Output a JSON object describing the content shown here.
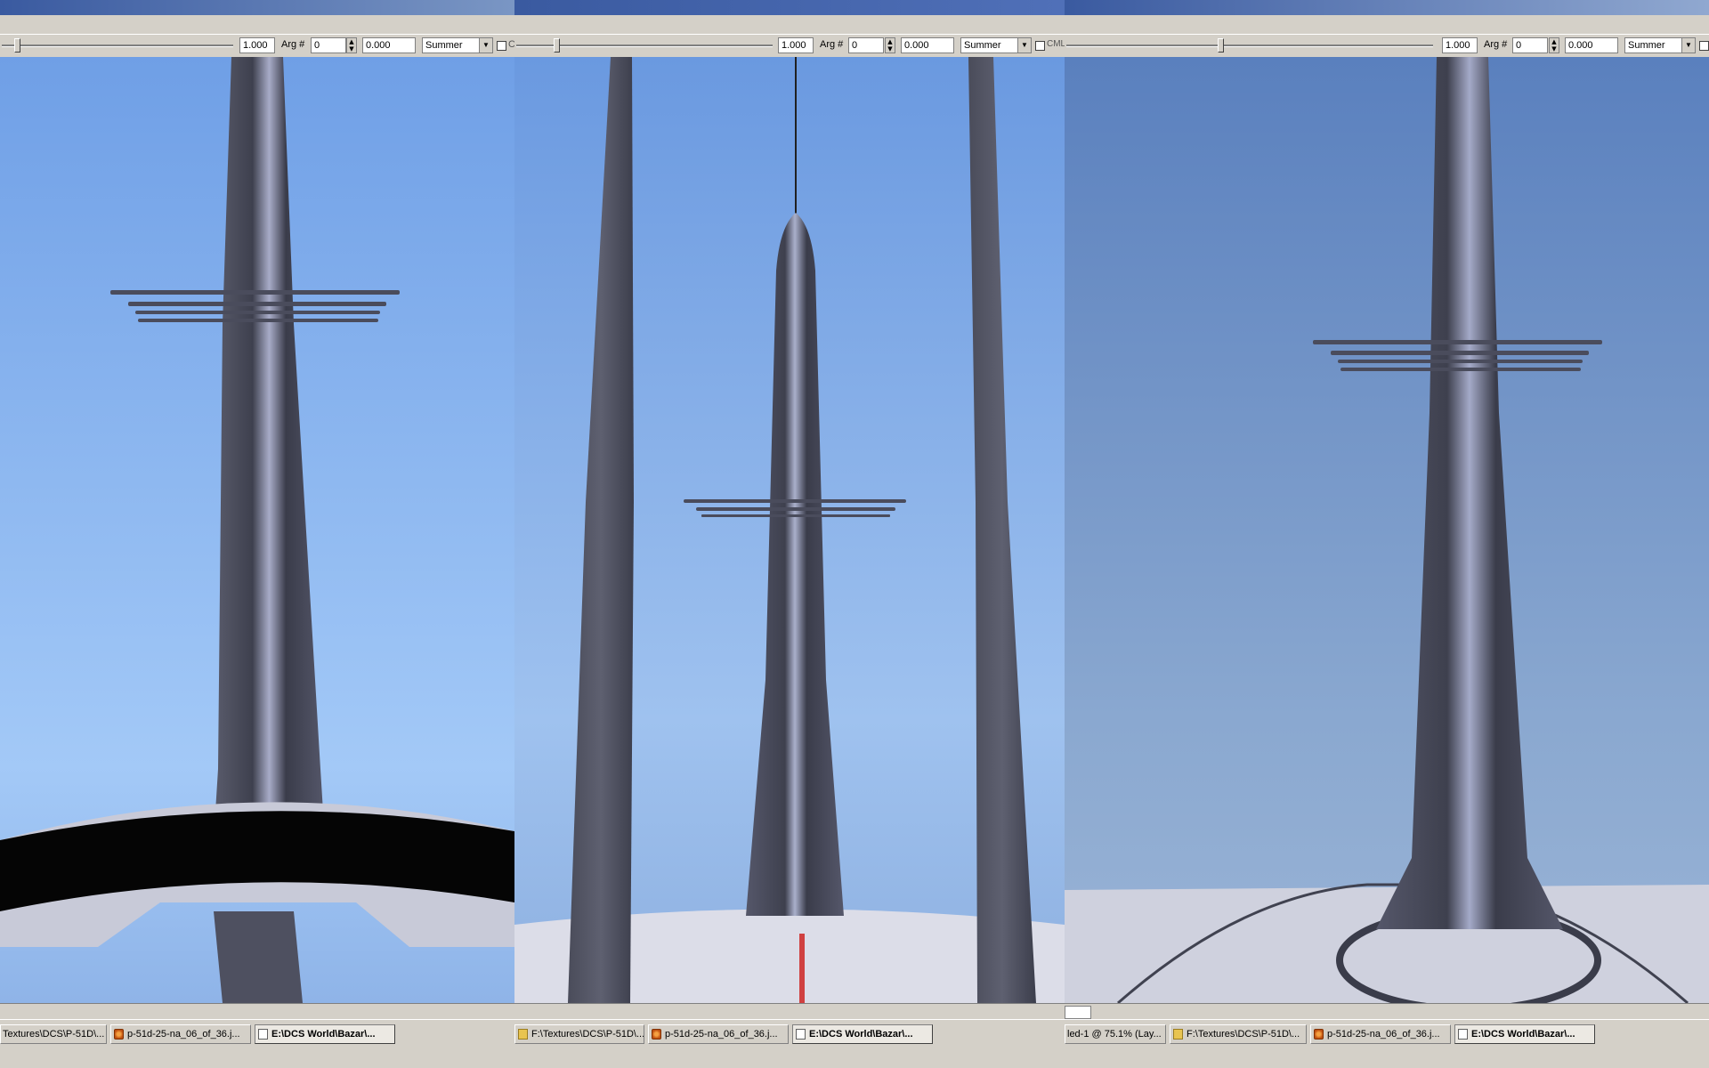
{
  "panes": [
    {
      "toolbar": {
        "scale_value": "1.000",
        "arg_label": "Arg #",
        "arg_value": "0",
        "arg_float": "0.000",
        "season": "Summer",
        "checkbox_label": "C"
      },
      "taskbar": [
        {
          "label": "Textures\\DCS\\P-51D\\...",
          "icon": "folder-icon",
          "active": false
        },
        {
          "label": "p-51d-25-na_06_of_36.j...",
          "icon": "image-icon",
          "active": false
        },
        {
          "label": "E:\\DCS World\\Bazar\\...",
          "icon": "document-icon",
          "active": true
        }
      ]
    },
    {
      "toolbar": {
        "scale_value": "1.000",
        "arg_label": "Arg #",
        "arg_value": "0",
        "arg_float": "0.000",
        "season": "Summer",
        "checkbox_label": "CML"
      },
      "taskbar": [
        {
          "label": "F:\\Textures\\DCS\\P-51D\\...",
          "icon": "folder-icon",
          "active": false
        },
        {
          "label": "p-51d-25-na_06_of_36.j...",
          "icon": "image-icon",
          "active": false
        },
        {
          "label": "E:\\DCS World\\Bazar\\...",
          "icon": "document-icon",
          "active": true
        }
      ]
    },
    {
      "toolbar": {
        "scale_value": "1.000",
        "arg_label": "Arg #",
        "arg_value": "0",
        "arg_float": "0.000",
        "season": "Summer",
        "checkbox_label": ""
      },
      "taskbar": [
        {
          "label": "led-1 @ 75.1% (Lay...",
          "icon": "image-icon",
          "active": false
        },
        {
          "label": "F:\\Textures\\DCS\\P-51D\\...",
          "icon": "folder-icon",
          "active": false
        },
        {
          "label": "p-51d-25-na_06_of_36.j...",
          "icon": "image-icon",
          "active": false
        },
        {
          "label": "E:\\DCS World\\Bazar\\...",
          "icon": "document-icon",
          "active": true
        }
      ]
    }
  ],
  "colors": {
    "sky_top": "#6f9fe6",
    "sky_bottom": "#a3c9f7",
    "tail_metal": "#4a4c5c",
    "fuselage": "#dcdde8",
    "titlebar_active": "#3a5aa0",
    "titlebar_inactive": "#7a96c4"
  }
}
